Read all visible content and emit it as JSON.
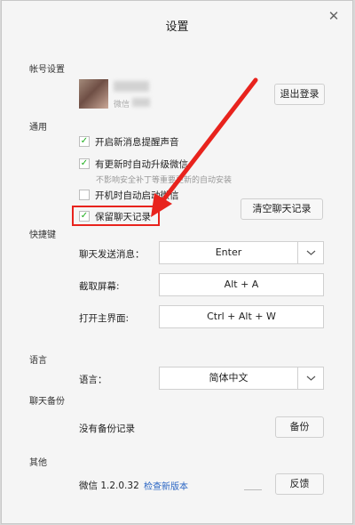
{
  "window": {
    "title": "设置",
    "close_glyph": "✕"
  },
  "sections": {
    "account": "帐号设置",
    "general": "通用",
    "shortcuts": "快捷键",
    "language": "语言",
    "backup": "聊天备份",
    "other": "其他"
  },
  "account": {
    "name_prefix": "微信",
    "logout_label": "退出登录"
  },
  "general": {
    "items": [
      {
        "label": "开启新消息提醒声音",
        "checked": true
      },
      {
        "label": "有更新时自动升级微信",
        "checked": true
      },
      {
        "label": "开机时自动启动微信",
        "checked": false
      },
      {
        "label": "保留聊天记录",
        "checked": true
      }
    ],
    "update_hint": "不影响安全补丁等重要更新的自动安装",
    "clear_label": "清空聊天记录",
    "check_glyph": "✓"
  },
  "shortcuts": [
    {
      "label": "聊天发送消息：",
      "value": "Enter"
    },
    {
      "label": "截取屏幕:",
      "value": "Alt + A"
    },
    {
      "label": "打开主界面:",
      "value": "Ctrl + Alt + W"
    }
  ],
  "language": {
    "label": "语言：",
    "value": "简体中文"
  },
  "backup": {
    "empty_text": "没有备份记录",
    "backup_label": "备份"
  },
  "other": {
    "version": "微信 1.2.0.32",
    "check_update": "检查新版本",
    "feedback_label": "反馈"
  },
  "colors": {
    "highlight": "#e8231d",
    "check": "#1aad19",
    "link": "#2b66c4"
  }
}
